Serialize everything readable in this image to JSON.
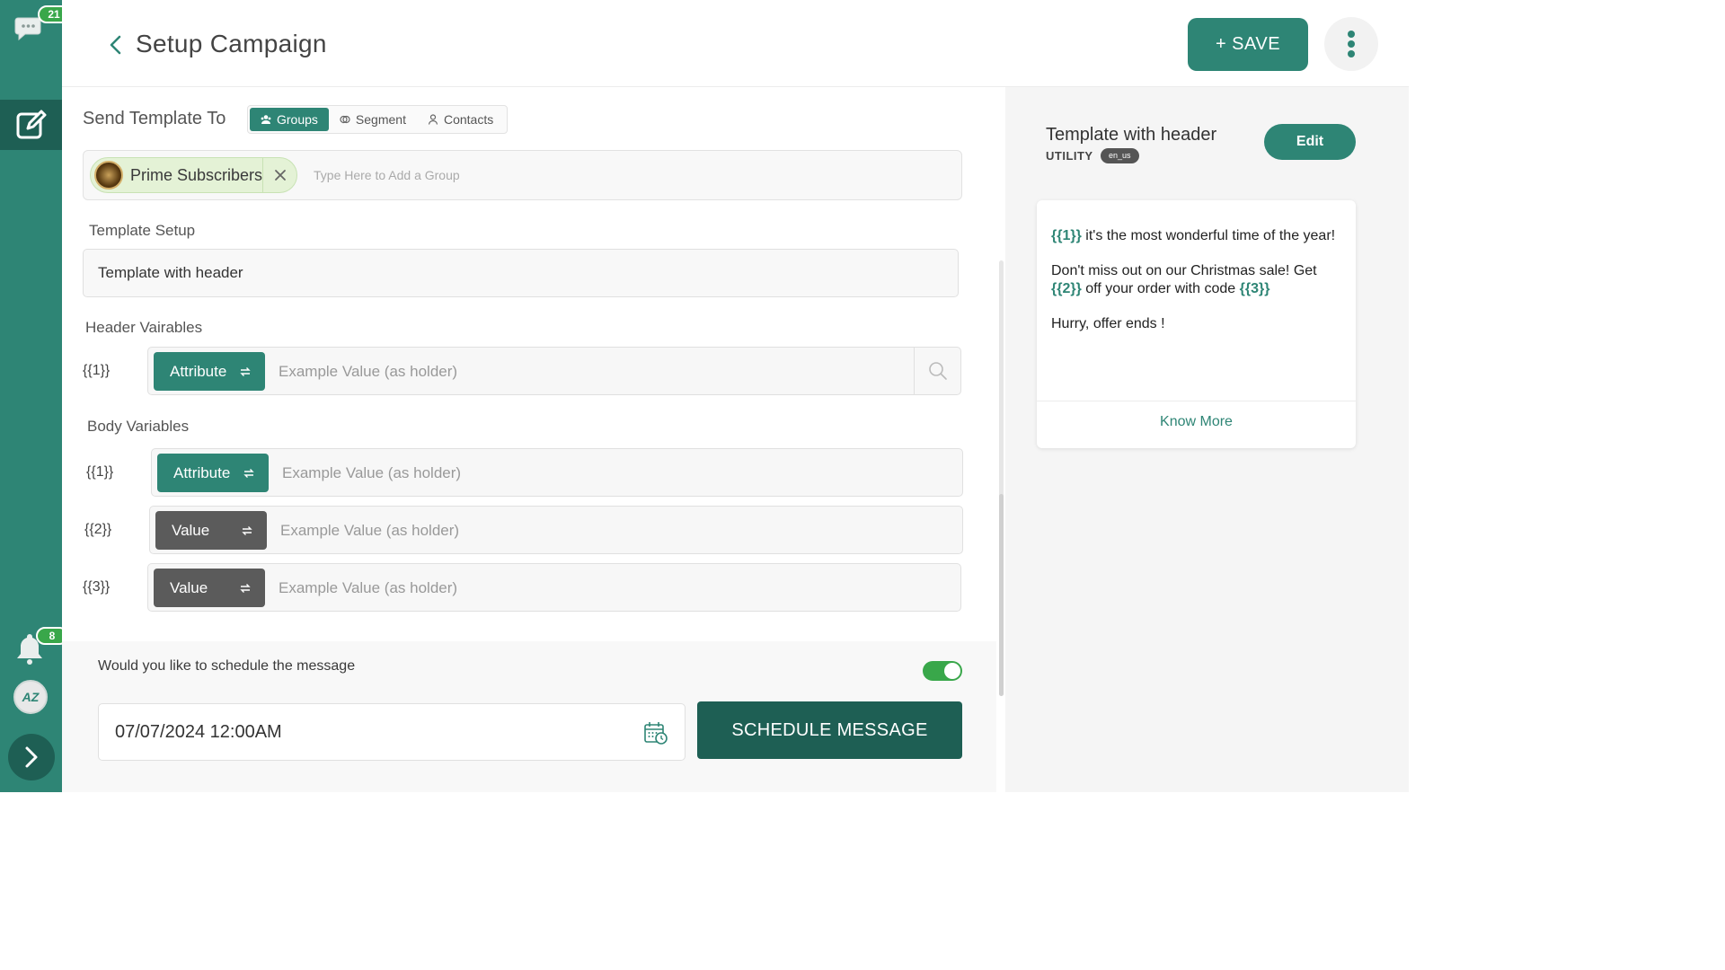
{
  "sidebar": {
    "chat_badge": "21",
    "bell_badge": "8",
    "avatar_text": "AZ"
  },
  "header": {
    "title": "Setup Campaign",
    "save_label": "+ SAVE"
  },
  "send_to": {
    "label": "Send Template To",
    "tabs": [
      {
        "label": "Groups",
        "icon": "groups-icon",
        "active": true
      },
      {
        "label": "Segment",
        "icon": "segment-icon",
        "active": false
      },
      {
        "label": "Contacts",
        "icon": "contact-icon",
        "active": false
      }
    ],
    "selected_group": "Prime Subscribers",
    "placeholder": "Type Here to Add a Group"
  },
  "template_setup": {
    "label": "Template Setup",
    "value": "Template with header"
  },
  "header_variables": {
    "label": "Header Vairables",
    "rows": [
      {
        "token": "{{1}}",
        "type": "Attribute",
        "placeholder": "Example Value (as holder)"
      }
    ]
  },
  "body_variables": {
    "label": "Body Variables",
    "rows": [
      {
        "token": "{{1}}",
        "type": "Attribute",
        "placeholder": "Example Value (as holder)"
      },
      {
        "token": "{{2}}",
        "type": "Value",
        "placeholder": "Example Value (as holder)"
      },
      {
        "token": "{{3}}",
        "type": "Value",
        "placeholder": "Example Value (as holder)"
      }
    ]
  },
  "schedule": {
    "question": "Would you like to schedule the message",
    "enabled": true,
    "datetime": "07/07/2024 12:00AM",
    "button_label": "SCHEDULE MESSAGE"
  },
  "preview": {
    "title": "Template with header",
    "category": "UTILITY",
    "language": "en_us",
    "edit_label": "Edit",
    "line1_token": "{{1}}",
    "line1_text": " it's the most wonderful time of the year!",
    "line2_text": "Don't miss out on our Christmas sale! Get ",
    "line2_token1": "{{2}}",
    "line2_mid": " off your order with code ",
    "line2_token2": "{{3}}",
    "line3_text": "Hurry, offer ends !",
    "know_more": "Know More"
  },
  "colors": {
    "brand": "#2e8575",
    "brand_dark": "#1e5f54",
    "badge_green": "#39a74a",
    "value_gray": "#5b5b5b"
  }
}
